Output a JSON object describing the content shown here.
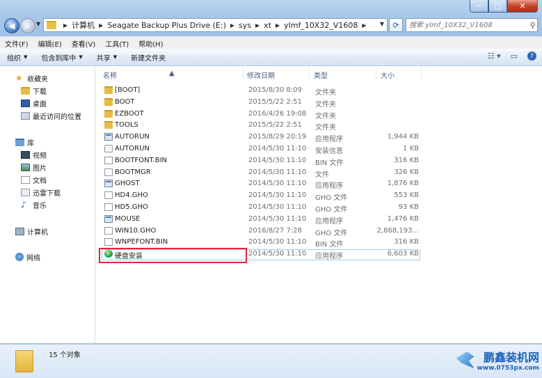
{
  "window": {
    "caption_buttons": {
      "minimize": "─",
      "maximize": "□",
      "close": "✕"
    }
  },
  "address": {
    "crumbs": [
      "计算机",
      "Seagate Backup Plus Drive (E:)",
      "sys",
      "xt",
      "ylmf_10X32_V1608"
    ],
    "search_placeholder": "搜索 ylmf_10X32_V1608"
  },
  "menu": [
    "文件(F)",
    "编辑(E)",
    "查看(V)",
    "工具(T)",
    "帮助(H)"
  ],
  "commands": {
    "organize": "组织",
    "include_in_library": "包含到库中",
    "share": "共享",
    "new_folder": "新建文件夹"
  },
  "nav": {
    "favorites": "收藏夹",
    "downloads": "下载",
    "desktop": "桌面",
    "recent": "最近访问的位置",
    "libraries": "库",
    "videos": "视频",
    "pictures": "图片",
    "documents": "文档",
    "xunlei": "迅雷下载",
    "music": "音乐",
    "computer": "计算机",
    "network": "网络"
  },
  "columns": {
    "name": "名称",
    "modified": "修改日期",
    "type": "类型",
    "size": "大小"
  },
  "files": [
    {
      "name": "[BOOT]",
      "date": "2015/8/30 8:09",
      "type": "文件夹",
      "size": "",
      "icon": "folder-icon"
    },
    {
      "name": "BOOT",
      "date": "2015/5/22 2:51",
      "type": "文件夹",
      "size": "",
      "icon": "folder-icon"
    },
    {
      "name": "EZBOOT",
      "date": "2016/4/26 19:08",
      "type": "文件夹",
      "size": "",
      "icon": "folder-icon"
    },
    {
      "name": "TOOLS",
      "date": "2015/5/22 2:51",
      "type": "文件夹",
      "size": "",
      "icon": "folder-icon"
    },
    {
      "name": "AUTORUN",
      "date": "2015/8/29 20:19",
      "type": "应用程序",
      "size": "1,944 KB",
      "icon": "app-icon"
    },
    {
      "name": "AUTORUN",
      "date": "2014/5/30 11:10",
      "type": "安装信息",
      "size": "1 KB",
      "icon": "setup-info-icon"
    },
    {
      "name": "BOOTFONT.BIN",
      "date": "2014/5/30 11:10",
      "type": "BIN 文件",
      "size": "316 KB",
      "icon": "file-icon"
    },
    {
      "name": "BOOTMGR",
      "date": "2014/5/30 11:10",
      "type": "文件",
      "size": "326 KB",
      "icon": "file-icon"
    },
    {
      "name": "GHOST",
      "date": "2014/5/30 11:10",
      "type": "应用程序",
      "size": "1,876 KB",
      "icon": "app-icon"
    },
    {
      "name": "HD4.GHO",
      "date": "2014/5/30 11:10",
      "type": "GHO 文件",
      "size": "553 KB",
      "icon": "file-icon"
    },
    {
      "name": "HD5.GHO",
      "date": "2014/5/30 11:10",
      "type": "GHO 文件",
      "size": "93 KB",
      "icon": "file-icon"
    },
    {
      "name": "MOUSE",
      "date": "2014/5/30 11:10",
      "type": "应用程序",
      "size": "1,476 KB",
      "icon": "app-icon"
    },
    {
      "name": "WIN10.GHO",
      "date": "2016/8/27 7:28",
      "type": "GHO 文件",
      "size": "2,868,193...",
      "icon": "file-icon"
    },
    {
      "name": "WNPEFONT.BIN",
      "date": "2014/5/30 11:10",
      "type": "BIN 文件",
      "size": "316 KB",
      "icon": "file-icon"
    },
    {
      "name": "硬盘安装",
      "date": "2014/5/30 11:10",
      "type": "应用程序",
      "size": "6,603 KB",
      "icon": "installer-globe-icon"
    }
  ],
  "status": {
    "count_text": "15 个对象"
  },
  "watermark": {
    "brand": "鹏鑫装机网",
    "url": "www.0753px.com"
  }
}
